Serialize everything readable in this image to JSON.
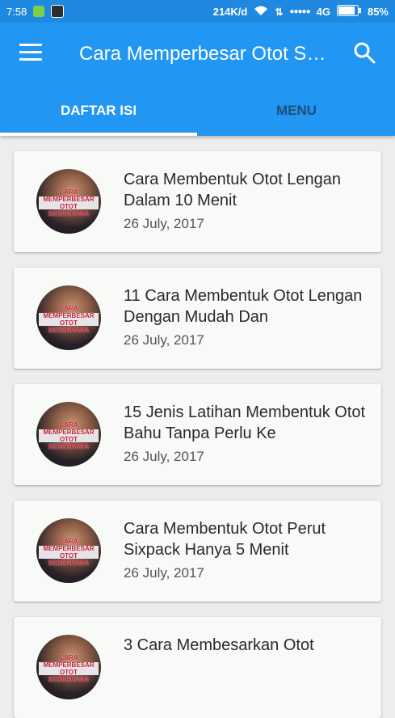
{
  "status_bar": {
    "time": "7:58",
    "net_speed": "214K/d",
    "signal": "●●●●●",
    "network": "4G",
    "battery": "85%"
  },
  "app_bar": {
    "title": "Cara Memperbesar Otot Sederhana",
    "icons": [
      "menu-icon",
      "search-icon"
    ]
  },
  "tabs": [
    {
      "label": "DAFTAR ISI",
      "selected": true
    },
    {
      "label": "MENU",
      "selected": false
    }
  ],
  "thumbnail_text": [
    "CARA",
    "MEMPERBESAR",
    "OTOT",
    "SEDERHANA"
  ],
  "articles": [
    {
      "title": "Cara Membentuk Otot Lengan Dalam 10 Menit",
      "date": "26 July, 2017"
    },
    {
      "title": "11 Cara Membentuk Otot Lengan Dengan Mudah Dan",
      "date": "26 July, 2017"
    },
    {
      "title": "15 Jenis Latihan Membentuk Otot Bahu Tanpa Perlu Ke",
      "date": "26 July, 2017"
    },
    {
      "title": "Cara Membentuk Otot Perut Sixpack Hanya 5 Menit",
      "date": "26 July, 2017"
    },
    {
      "title": "3 Cara Membesarkan Otot",
      "date": ""
    }
  ],
  "colors": {
    "primary": "#2196f3",
    "status_bar": "#1f88e0",
    "background": "#ededed",
    "card": "#f7faf6"
  }
}
